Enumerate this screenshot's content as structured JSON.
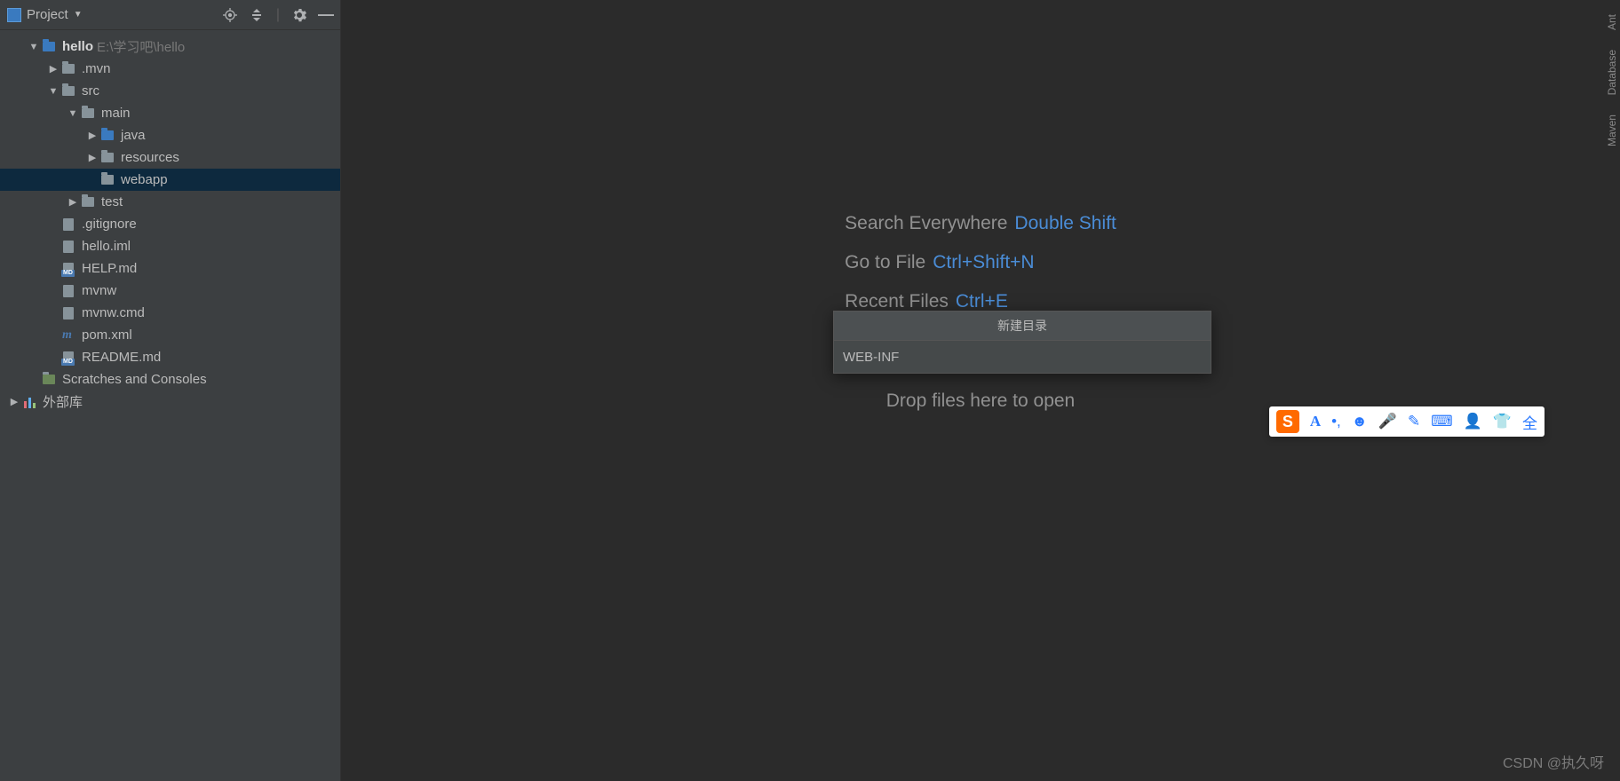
{
  "sidebar": {
    "title": "Project",
    "tree": [
      {
        "indent": 0,
        "arrow": "▼",
        "icon": "folder-blue",
        "label": "hello",
        "bold": true,
        "path": "E:\\学习吧\\hello"
      },
      {
        "indent": 1,
        "arrow": "▶",
        "icon": "folder",
        "label": ".mvn"
      },
      {
        "indent": 1,
        "arrow": "▼",
        "icon": "folder",
        "label": "src"
      },
      {
        "indent": 2,
        "arrow": "▼",
        "icon": "folder",
        "label": "main"
      },
      {
        "indent": 3,
        "arrow": "▶",
        "icon": "folder-blue",
        "label": "java"
      },
      {
        "indent": 3,
        "arrow": "▶",
        "icon": "folder-res",
        "label": "resources"
      },
      {
        "indent": 3,
        "arrow": "",
        "icon": "folder",
        "label": "webapp",
        "selected": true
      },
      {
        "indent": 2,
        "arrow": "▶",
        "icon": "folder",
        "label": "test"
      },
      {
        "indent": 1,
        "arrow": "",
        "icon": "file",
        "label": ".gitignore"
      },
      {
        "indent": 1,
        "arrow": "",
        "icon": "file",
        "label": "hello.iml"
      },
      {
        "indent": 1,
        "arrow": "",
        "icon": "file-md",
        "label": "HELP.md"
      },
      {
        "indent": 1,
        "arrow": "",
        "icon": "file",
        "label": "mvnw"
      },
      {
        "indent": 1,
        "arrow": "",
        "icon": "file",
        "label": "mvnw.cmd"
      },
      {
        "indent": 1,
        "arrow": "",
        "icon": "maven",
        "label": "pom.xml"
      },
      {
        "indent": 1,
        "arrow": "",
        "icon": "file-md",
        "label": "README.md"
      },
      {
        "indent": 0,
        "arrow": "",
        "icon": "folder-scratch",
        "label": "Scratches and Consoles"
      },
      {
        "indent": -1,
        "arrow": "▶",
        "icon": "bars",
        "label": "外部库"
      }
    ]
  },
  "hints": {
    "search_label": "Search Everywhere",
    "search_key": "Double Shift",
    "goto_label": "Go to File",
    "goto_key": "Ctrl+Shift+N",
    "recent_label": "Recent Files",
    "recent_key": "Ctrl+E",
    "drop": "Drop files here to open"
  },
  "dialog": {
    "title": "新建目录",
    "value": "WEB-INF"
  },
  "right_tabs": {
    "ant": "Ant",
    "db": "Database",
    "maven": "Maven"
  },
  "ime": {
    "char_a": "A",
    "char_full": "全"
  },
  "watermark": "CSDN @执久呀"
}
